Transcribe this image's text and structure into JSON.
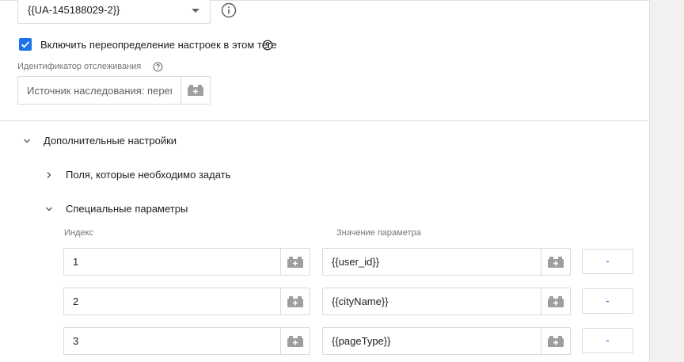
{
  "tracking_select": {
    "value": "{{UA-145188029-2}}"
  },
  "override": {
    "checked": true,
    "label": "Включить переопределение настроек в этом теге"
  },
  "tracking_id": {
    "label": "Идентификатор отслеживания",
    "placeholder": "Источник наследования: перем"
  },
  "advanced": {
    "title": "Дополнительные настройки",
    "fields_to_set": "Поля, которые необходимо задать",
    "custom_dimensions": {
      "title": "Специальные параметры",
      "col_index": "Индекс",
      "col_value": "Значение параметра",
      "rows": [
        {
          "index": "1",
          "value": "{{user_id}}",
          "remove": "-"
        },
        {
          "index": "2",
          "value": "{{cityName}}",
          "remove": "-"
        },
        {
          "index": "3",
          "value": "{{pageType}}",
          "remove": "-"
        }
      ]
    }
  },
  "colors": {
    "accent": "#1a73e8",
    "icon": "#9e9e9e",
    "border": "#dadada",
    "muted_text": "#757575"
  }
}
